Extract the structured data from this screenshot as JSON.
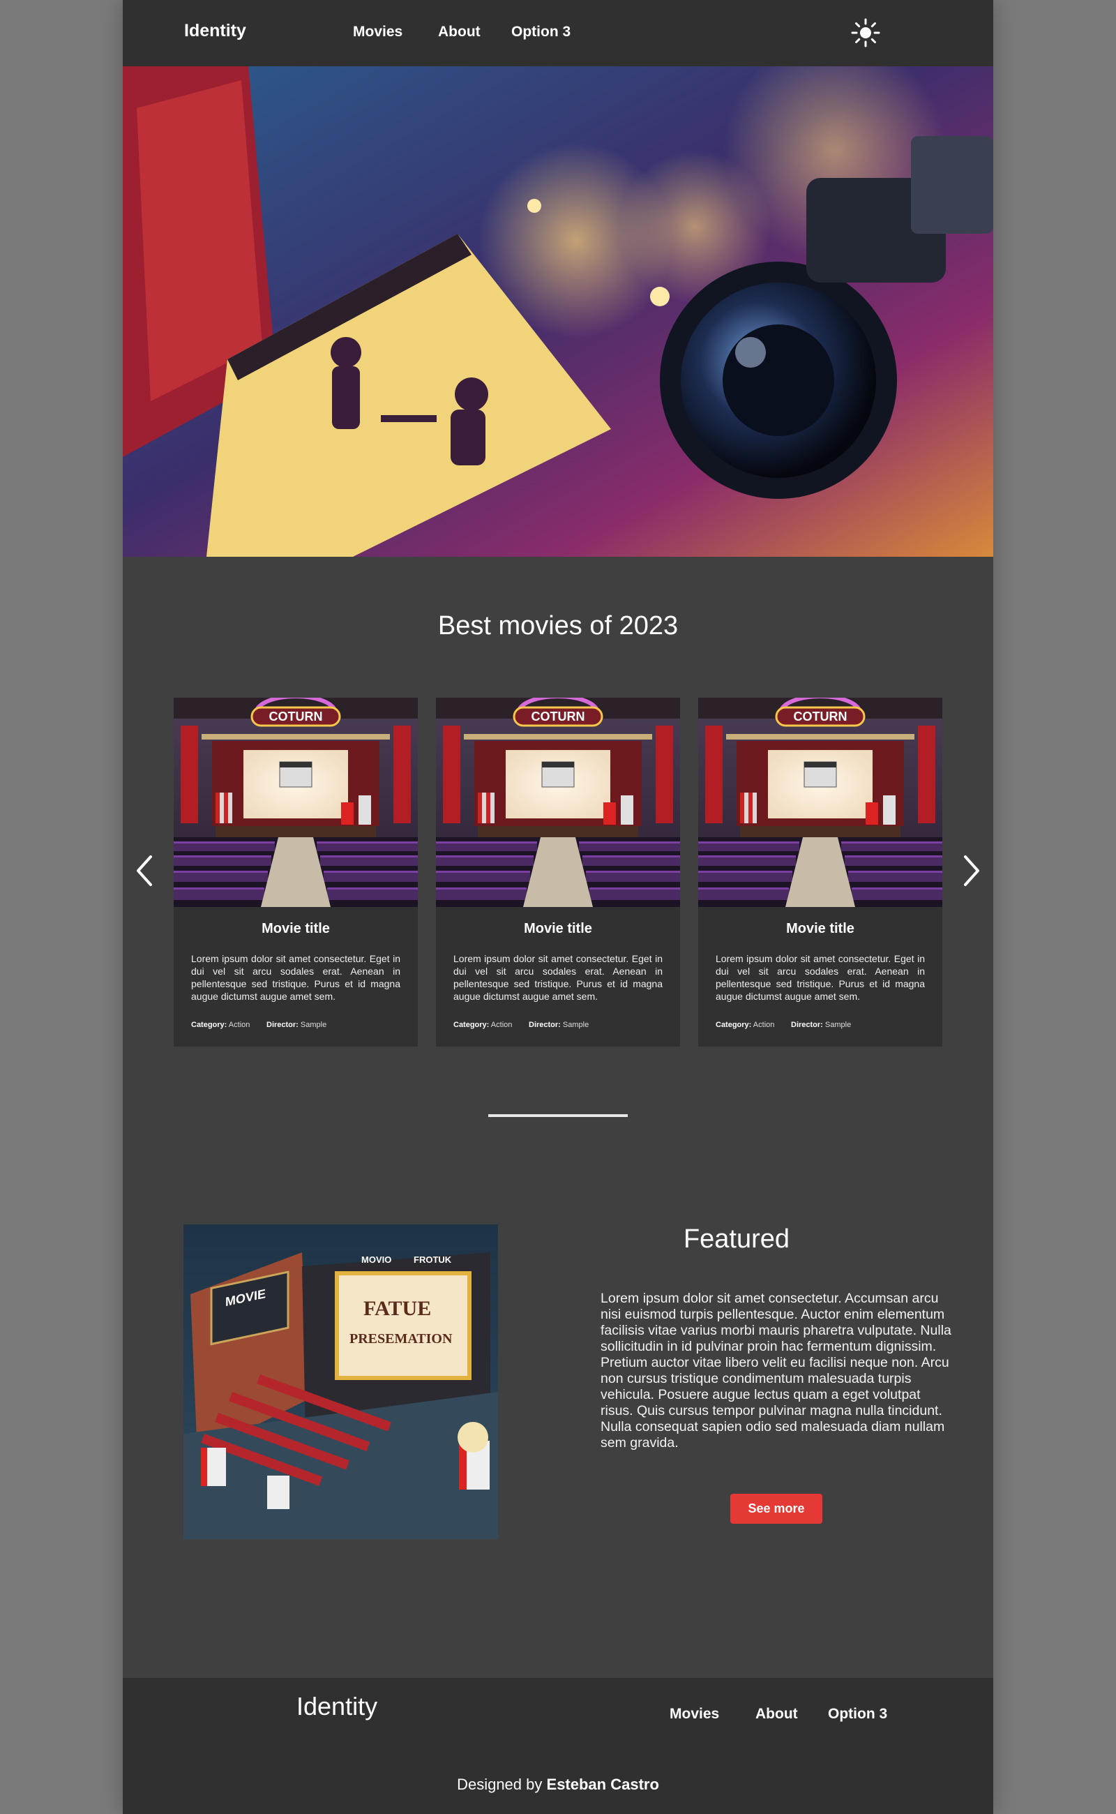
{
  "header": {
    "brand": "Identity",
    "nav": [
      "Movies",
      "About",
      "Option 3"
    ],
    "theme_icon": "sun-icon"
  },
  "hero": {
    "image": "cinema-puzzle-illustration"
  },
  "best": {
    "title": "Best movies of 2023",
    "cards": [
      {
        "marquee": "COTURN",
        "title": "Movie title",
        "text": "Lorem ipsum dolor sit amet consectetur. Eget in dui vel sit arcu sodales erat. Aenean in pellentesque sed tristique. Purus et id magna augue dictumst augue amet sem.",
        "category_label": "Category:",
        "category": "Action",
        "director_label": "Director:",
        "director": "Sample"
      },
      {
        "marquee": "COTURN",
        "title": "Movie title",
        "text": "Lorem ipsum dolor sit amet consectetur. Eget in dui vel sit arcu sodales erat. Aenean in pellentesque sed tristique. Purus et id magna augue dictumst augue amet sem.",
        "category_label": "Category:",
        "category": "Action",
        "director_label": "Director:",
        "director": "Sample"
      },
      {
        "marquee": "COTURN",
        "title": "Movie title",
        "text": "Lorem ipsum dolor sit amet consectetur. Eget in dui vel sit arcu sodales erat. Aenean in pellentesque sed tristique. Purus et id magna augue dictumst augue amet sem.",
        "category_label": "Category:",
        "category": "Action",
        "director_label": "Director:",
        "director": "Sample"
      }
    ],
    "prev_icon": "chevron-left-icon",
    "next_icon": "chevron-right-icon"
  },
  "featured": {
    "title": "Featured",
    "text": "Lorem ipsum dolor sit amet consectetur. Accumsan arcu nisi euismod turpis pellentesque. Auctor enim elementum facilisis vitae varius morbi mauris pharetra vulputate. Nulla sollicitudin in id pulvinar proin hac fermentum dignissim. Pretium auctor vitae libero velit eu facilisi neque non. Arcu non cursus tristique condimentum malesuada turpis vehicula. Posuere augue lectus quam a eget volutpat risus. Quis cursus tempor pulvinar magna nulla tincidunt. Nulla consequat sapien odio sed malesuada diam nullam sem gravida.",
    "button": "See more",
    "image_sign": {
      "marquee_left": "MOVIE",
      "marquee_top_a": "MOVIO",
      "marquee_top_b": "FROTUK",
      "screen_line1": "FATUE",
      "screen_line2": "PRESEMATION"
    }
  },
  "colors": {
    "accent": "#e53935",
    "page_bg": "#404040",
    "bar_bg": "#303030",
    "outer_bg": "#7a7a7a"
  },
  "footer": {
    "brand": "Identity",
    "nav": [
      "Movies",
      "About",
      "Option 3"
    ],
    "credit_prefix": "Designed by",
    "credit_name": "Esteban Castro"
  }
}
